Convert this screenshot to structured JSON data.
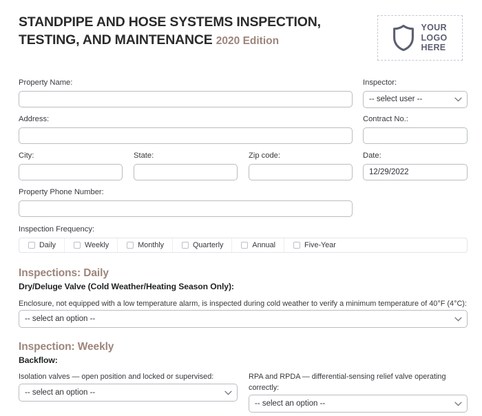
{
  "header": {
    "title_line1": "STANDPIPE AND HOSE SYSTEMS INSPECTION,",
    "title_line2": "TESTING, AND MAINTENANCE",
    "edition": "2020 Edition",
    "logo": {
      "icon": "shield-icon",
      "line1": "YOUR",
      "line2": "LOGO",
      "line3": "HERE"
    }
  },
  "form": {
    "property_name": {
      "label": "Property Name:",
      "value": ""
    },
    "inspector": {
      "label": "Inspector:",
      "value": "-- select user --"
    },
    "address": {
      "label": "Address:",
      "value": ""
    },
    "contract_no": {
      "label": "Contract No.:",
      "value": ""
    },
    "city": {
      "label": "City:",
      "value": ""
    },
    "state": {
      "label": "State:",
      "value": ""
    },
    "zip_code": {
      "label": "Zip code:",
      "value": ""
    },
    "date": {
      "label": "Date:",
      "value": "12/29/2022"
    },
    "property_phone": {
      "label": "Property Phone Number:",
      "value": ""
    },
    "inspection_frequency": {
      "label": "Inspection Frequency:",
      "options": [
        {
          "label": "Daily",
          "checked": false
        },
        {
          "label": "Weekly",
          "checked": false
        },
        {
          "label": "Monthly",
          "checked": false
        },
        {
          "label": "Quarterly",
          "checked": false
        },
        {
          "label": "Annual",
          "checked": false
        },
        {
          "label": "Five-Year",
          "checked": false
        }
      ]
    }
  },
  "sections": {
    "daily": {
      "heading": "Inspections: Daily",
      "subheading": "Dry/Deluge Valve (Cold Weather/Heating Season Only):",
      "question": "Enclosure, not equipped with a low temperature alarm, is inspected during cold weather to verify a minimum temperature of 40°F (4°C):",
      "select_value": "-- select an option --"
    },
    "weekly": {
      "heading": "Inspection: Weekly",
      "subheading": "Backflow:",
      "question_left": "Isolation valves — open position and locked or supervised:",
      "select_left_value": "-- select an option --",
      "question_right": "RPA and RPDA — differential-sensing relief valve operating correctly:",
      "select_right_value": "-- select an option --"
    }
  },
  "colors": {
    "accent": "#9d857b",
    "title": "#2b2b2b",
    "border": "#b9bcc0",
    "logo": "#5b5f72"
  }
}
